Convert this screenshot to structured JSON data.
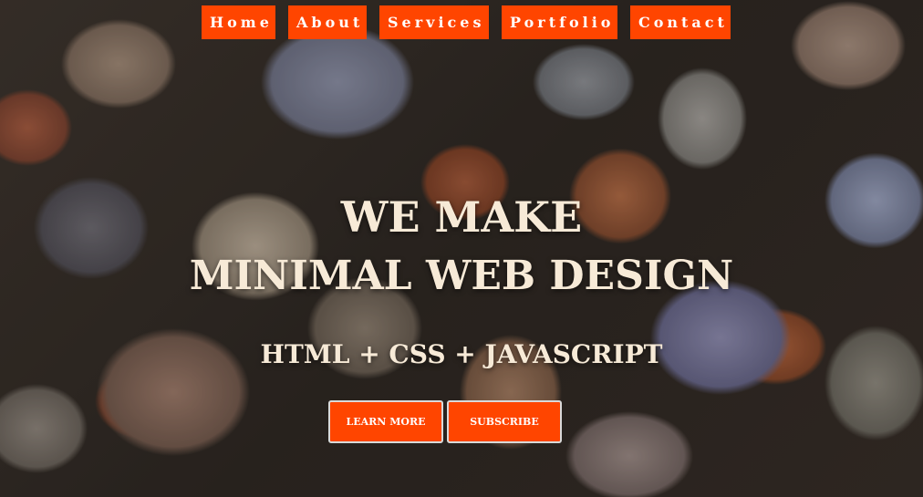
{
  "nav": {
    "items": [
      {
        "label": "Home"
      },
      {
        "label": "About"
      },
      {
        "label": "Services"
      },
      {
        "label": "Portfolio"
      },
      {
        "label": "Contact"
      }
    ]
  },
  "hero": {
    "title_line_1": "WE MAKE",
    "title_line_2": "MINIMAL WEB DESIGN",
    "subtitle": "HTML + CSS + JAVASCRIPT",
    "buttons": {
      "learn_more": "LEARN MORE",
      "subscribe": "SUBSCRIBE"
    }
  },
  "colors": {
    "accent": "#ff4500",
    "hero_text": "#f7ead7",
    "button_text": "#ffffff"
  }
}
